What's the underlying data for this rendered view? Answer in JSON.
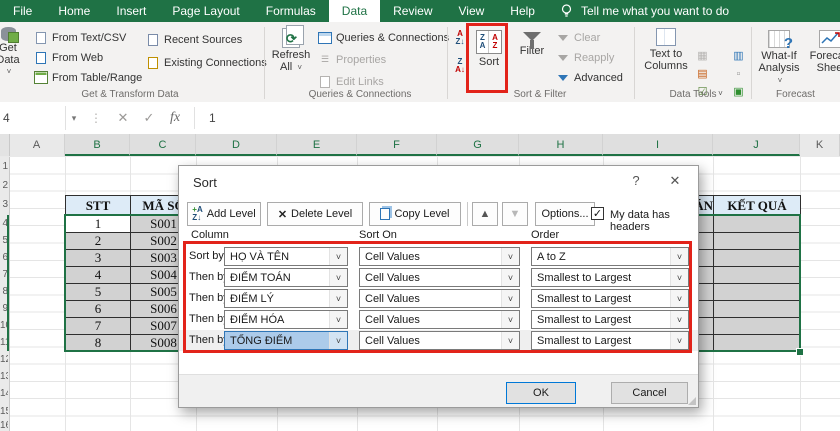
{
  "ribbon": {
    "tabs": [
      "File",
      "Home",
      "Insert",
      "Page Layout",
      "Formulas",
      "Data",
      "Review",
      "View",
      "Help"
    ],
    "selected_tab": "Data",
    "tell_me": "Tell me what you want to do",
    "get_transform": {
      "label": "Get & Transform Data",
      "get_data": "Get Data",
      "from_text_csv": "From Text/CSV",
      "from_web": "From Web",
      "from_table_range": "From Table/Range",
      "recent_sources": "Recent Sources",
      "existing_connections": "Existing Connections"
    },
    "queries": {
      "label": "Queries & Connections",
      "refresh_line1": "Refresh",
      "refresh_line2": "All",
      "queries_connections": "Queries & Connections",
      "properties": "Properties",
      "edit_links": "Edit Links"
    },
    "sort_filter": {
      "label": "Sort & Filter",
      "sort": "Sort",
      "filter": "Filter",
      "clear": "Clear",
      "reapply": "Reapply",
      "advanced": "Advanced"
    },
    "data_tools": {
      "label": "Data Tools",
      "text_to_columns_line1": "Text to",
      "text_to_columns_line2": "Columns"
    },
    "forecast": {
      "label": "Forecast",
      "what_if_line1": "What-If",
      "what_if_line2": "Analysis",
      "sheet_line1": "Forecast",
      "sheet_line2": "Sheet"
    }
  },
  "formula_bar": {
    "name_box": "4",
    "formula": "1",
    "fx_label": "fx"
  },
  "sheet": {
    "column_headers": [
      {
        "label": "A",
        "selected": false
      },
      {
        "label": "B",
        "selected": true
      },
      {
        "label": "C",
        "selected": true
      },
      {
        "label": "D",
        "selected": true
      },
      {
        "label": "E",
        "selected": true
      },
      {
        "label": "F",
        "selected": true
      },
      {
        "label": "G",
        "selected": true
      },
      {
        "label": "H",
        "selected": true
      },
      {
        "label": "I",
        "selected": true
      },
      {
        "label": "J",
        "selected": true
      },
      {
        "label": "K",
        "selected": false
      }
    ],
    "row_numbers": [
      "1",
      "2",
      "3",
      "4",
      "5",
      "6",
      "7",
      "8",
      "9",
      "10",
      "11",
      "12",
      "13",
      "14",
      "15",
      "16"
    ],
    "table": {
      "header_stt": "STT",
      "header_ma_so": "MÃ SỐ",
      "header_partial": "ÁN",
      "header_ket_qua": "KẾT QUẢ",
      "rows": [
        {
          "stt": "1",
          "ma_so": "S001"
        },
        {
          "stt": "2",
          "ma_so": "S002"
        },
        {
          "stt": "3",
          "ma_so": "S003"
        },
        {
          "stt": "4",
          "ma_so": "S004"
        },
        {
          "stt": "5",
          "ma_so": "S005"
        },
        {
          "stt": "6",
          "ma_so": "S006"
        },
        {
          "stt": "7",
          "ma_so": "S007"
        },
        {
          "stt": "8",
          "ma_so": "S008"
        }
      ]
    }
  },
  "dialog": {
    "title": "Sort",
    "help_glyph": "?",
    "close_glyph": "✕",
    "toolbar": {
      "add_level": "Add Level",
      "delete_level": "Delete Level",
      "copy_level": "Copy Level",
      "move_up_glyph": "▲",
      "move_down_glyph": "▼",
      "options": "Options...",
      "headers_checkbox_label": "My data has headers",
      "headers_checkbox_checked": true
    },
    "column_labels": [
      "Column",
      "Sort On",
      "Order"
    ],
    "levels": [
      {
        "label": "Sort by",
        "column": "HỌ VÀ TÊN",
        "sort_on": "Cell Values",
        "order": "A to Z",
        "selected": false
      },
      {
        "label": "Then by",
        "column": "ĐIỂM TOÁN",
        "sort_on": "Cell Values",
        "order": "Smallest to Largest",
        "selected": false
      },
      {
        "label": "Then by",
        "column": "ĐIỂM LÝ",
        "sort_on": "Cell Values",
        "order": "Smallest to Largest",
        "selected": false
      },
      {
        "label": "Then by",
        "column": "ĐIỂM HÓA",
        "sort_on": "Cell Values",
        "order": "Smallest to Largest",
        "selected": false
      },
      {
        "label": "Then by",
        "column": "TỔNG ĐIỂM",
        "sort_on": "Cell Values",
        "order": "Smallest to Largest",
        "selected": true
      }
    ],
    "ok": "OK",
    "cancel": "Cancel"
  },
  "colors": {
    "excel_green": "#1F7245",
    "highlight_red": "#E2231A",
    "table_header_blue": "#DDEBF7",
    "selection_gray": "#D2D2D2",
    "focus_blue": "#2E75B6"
  }
}
